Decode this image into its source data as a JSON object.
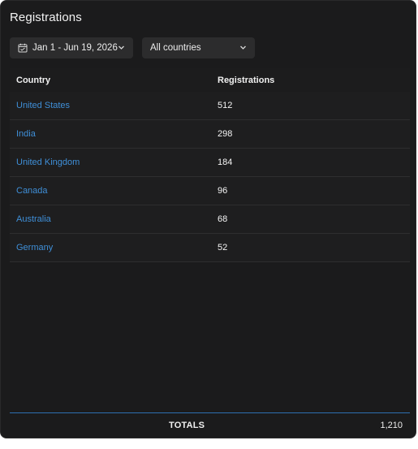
{
  "panel": {
    "title": "Registrations"
  },
  "filters": {
    "date_range": "Jan 1 - Jun 19, 2026",
    "country": "All countries"
  },
  "table": {
    "headers": [
      "Country",
      "Registrations"
    ],
    "rows": [
      {
        "country": "United States",
        "registrations": "512"
      },
      {
        "country": "India",
        "registrations": "298"
      },
      {
        "country": "United Kingdom",
        "registrations": "184"
      },
      {
        "country": "Canada",
        "registrations": "96"
      },
      {
        "country": "Australia",
        "registrations": "68"
      },
      {
        "country": "Germany",
        "registrations": "52"
      }
    ]
  },
  "totals": {
    "label": "TOTALS",
    "value": "1,210"
  },
  "icons": {
    "date_filter": "calendar-icon",
    "dropdown": "chevron-down-icon"
  },
  "colors": {
    "background": "#1b1b1c",
    "link": "#3f8fd8",
    "totals_border": "#2d6fb1"
  }
}
